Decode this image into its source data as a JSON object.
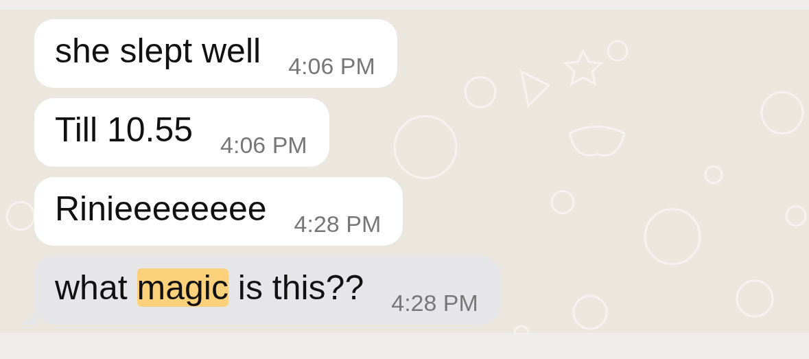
{
  "messages": [
    {
      "parts": [
        {
          "text": "she slept well",
          "highlighted": false
        }
      ],
      "time": "4:06 PM",
      "selected": false,
      "tail": false
    },
    {
      "parts": [
        {
          "text": "Till 10.55",
          "highlighted": false
        }
      ],
      "time": "4:06 PM",
      "selected": false,
      "tail": false
    },
    {
      "parts": [
        {
          "text": "Rinieeeeeeee",
          "highlighted": false
        }
      ],
      "time": "4:28 PM",
      "selected": false,
      "tail": false
    },
    {
      "parts": [
        {
          "text": "what ",
          "highlighted": false
        },
        {
          "text": "magic",
          "highlighted": true
        },
        {
          "text": " is this??",
          "highlighted": false
        }
      ],
      "time": "4:28 PM",
      "selected": true,
      "tail": true
    }
  ]
}
